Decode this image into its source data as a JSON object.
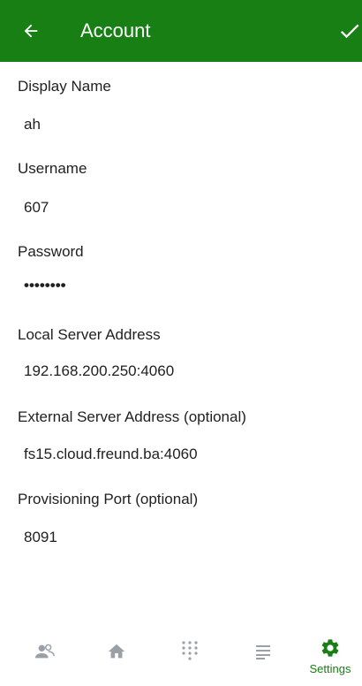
{
  "header": {
    "title": "Account",
    "back_icon": "arrow-back-icon",
    "confirm_icon": "check-icon"
  },
  "colors": {
    "primary": "#177f14",
    "nav_inactive": "#9aa0a6",
    "text": "#212121"
  },
  "fields": {
    "display_name": {
      "label": "Display Name",
      "value": "ah"
    },
    "username": {
      "label": "Username",
      "value": "607"
    },
    "password": {
      "label": "Password",
      "value": "••••••••"
    },
    "local_server": {
      "label": "Local Server Address",
      "value": "192.168.200.250:4060"
    },
    "external_server": {
      "label": "External Server Address (optional)",
      "value": "fs15.cloud.freund.ba:4060"
    },
    "provisioning_port": {
      "label": "Provisioning Port (optional)",
      "value": "8091"
    }
  },
  "bottom_nav": {
    "items": [
      {
        "icon": "contacts-icon",
        "label": ""
      },
      {
        "icon": "home-icon",
        "label": ""
      },
      {
        "icon": "dialpad-icon",
        "label": ""
      },
      {
        "icon": "history-list-icon",
        "label": ""
      },
      {
        "icon": "settings-gear-icon",
        "label": "Settings",
        "active": true
      }
    ]
  }
}
